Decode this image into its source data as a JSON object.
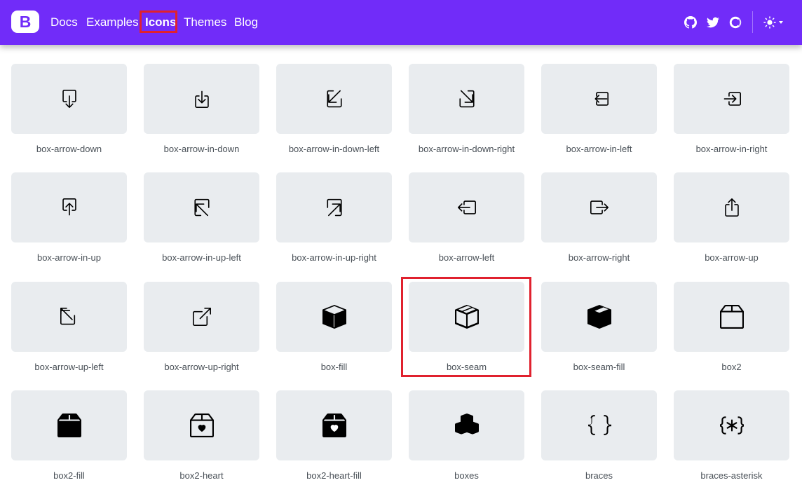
{
  "navbar": {
    "brand_letter": "B",
    "links": [
      {
        "label": "Docs",
        "active": false
      },
      {
        "label": "Examples",
        "active": false
      },
      {
        "label": "Icons",
        "active": true
      },
      {
        "label": "Themes",
        "active": false
      },
      {
        "label": "Blog",
        "active": false
      }
    ],
    "right_icons": [
      "github-icon",
      "twitter-icon",
      "opencollective-icon"
    ],
    "theme_toggle_icon": "sun-icon",
    "background_color": "#712cf9"
  },
  "icons": [
    {
      "name": "box-arrow-down",
      "icon": "box-arrow-down-icon"
    },
    {
      "name": "box-arrow-in-down",
      "icon": "box-arrow-in-down-icon"
    },
    {
      "name": "box-arrow-in-down-left",
      "icon": "box-arrow-in-down-left-icon"
    },
    {
      "name": "box-arrow-in-down-right",
      "icon": "box-arrow-in-down-right-icon"
    },
    {
      "name": "box-arrow-in-left",
      "icon": "box-arrow-in-left-icon"
    },
    {
      "name": "box-arrow-in-right",
      "icon": "box-arrow-in-right-icon"
    },
    {
      "name": "box-arrow-in-up",
      "icon": "box-arrow-in-up-icon"
    },
    {
      "name": "box-arrow-in-up-left",
      "icon": "box-arrow-in-up-left-icon"
    },
    {
      "name": "box-arrow-in-up-right",
      "icon": "box-arrow-in-up-right-icon"
    },
    {
      "name": "box-arrow-left",
      "icon": "box-arrow-left-icon"
    },
    {
      "name": "box-arrow-right",
      "icon": "box-arrow-right-icon"
    },
    {
      "name": "box-arrow-up",
      "icon": "box-arrow-up-icon"
    },
    {
      "name": "box-arrow-up-left",
      "icon": "box-arrow-up-left-icon"
    },
    {
      "name": "box-arrow-up-right",
      "icon": "box-arrow-up-right-icon"
    },
    {
      "name": "box-fill",
      "icon": "box-fill-icon"
    },
    {
      "name": "box-seam",
      "icon": "box-seam-icon"
    },
    {
      "name": "box-seam-fill",
      "icon": "box-seam-fill-icon"
    },
    {
      "name": "box2",
      "icon": "box2-icon"
    },
    {
      "name": "box2-fill",
      "icon": "box2-fill-icon"
    },
    {
      "name": "box2-heart",
      "icon": "box2-heart-icon"
    },
    {
      "name": "box2-heart-fill",
      "icon": "box2-heart-fill-icon"
    },
    {
      "name": "boxes",
      "icon": "boxes-icon"
    },
    {
      "name": "braces",
      "icon": "braces-icon"
    },
    {
      "name": "braces-asterisk",
      "icon": "braces-asterisk-icon"
    }
  ],
  "highlight_color": "#e0212e"
}
